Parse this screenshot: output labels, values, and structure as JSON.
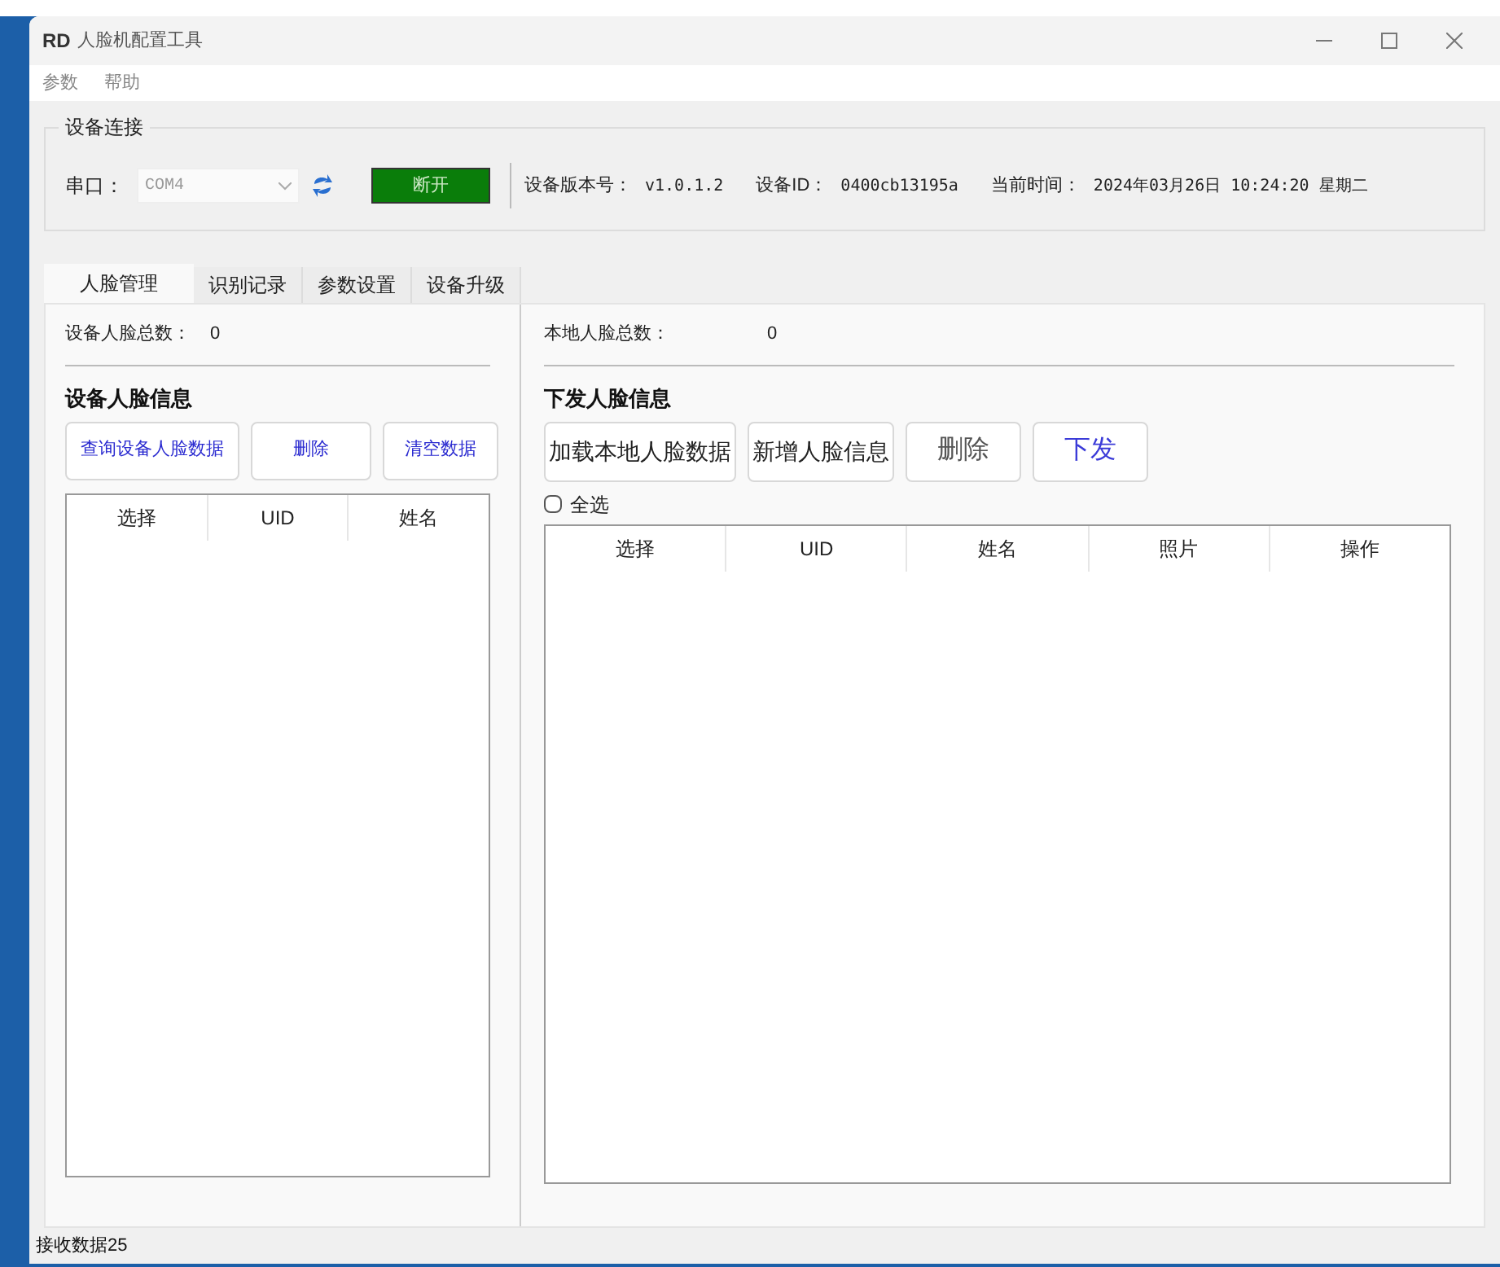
{
  "window": {
    "logo": "RD",
    "title": "人脸机配置工具"
  },
  "menu": [
    {
      "label": "参数"
    },
    {
      "label": "帮助"
    }
  ],
  "connection": {
    "title": "设备连接",
    "port_label": "串口：",
    "port_value": "COM4",
    "connect_button": "断开",
    "connected": true,
    "version_label": "设备版本号：",
    "version": "v1.0.1.2",
    "id_label": "设备ID：",
    "id": "0400cb13195a",
    "time_label": "当前时间：",
    "time": "2024年03月26日 10:24:20 星期二"
  },
  "tabs": [
    {
      "label": "人脸管理",
      "selected": true
    },
    {
      "label": "识别记录",
      "selected": false
    },
    {
      "label": "参数设置",
      "selected": false
    },
    {
      "label": "设备升级",
      "selected": false
    }
  ],
  "left": {
    "count_label": "设备人脸总数：",
    "count": "0",
    "heading": "设备人脸信息",
    "buttons": [
      "查询设备人脸数据",
      "删除",
      "清空数据"
    ],
    "columns": [
      "选择",
      "UID",
      "姓名"
    ]
  },
  "right": {
    "count_label": "本地人脸总数：",
    "count": "0",
    "heading": "下发人脸信息",
    "buttons": [
      {
        "label": "加载本地人脸数据",
        "kind": "plain"
      },
      {
        "label": "新增人脸信息",
        "kind": "plain"
      },
      {
        "label": "删除",
        "kind": "muted"
      },
      {
        "label": "下发",
        "kind": "accent"
      }
    ],
    "select_all": {
      "label": "全选",
      "checked": false
    },
    "columns": [
      "选择",
      "UID",
      "姓名",
      "照片",
      "操作"
    ]
  },
  "status_bar": "接收数据25"
}
